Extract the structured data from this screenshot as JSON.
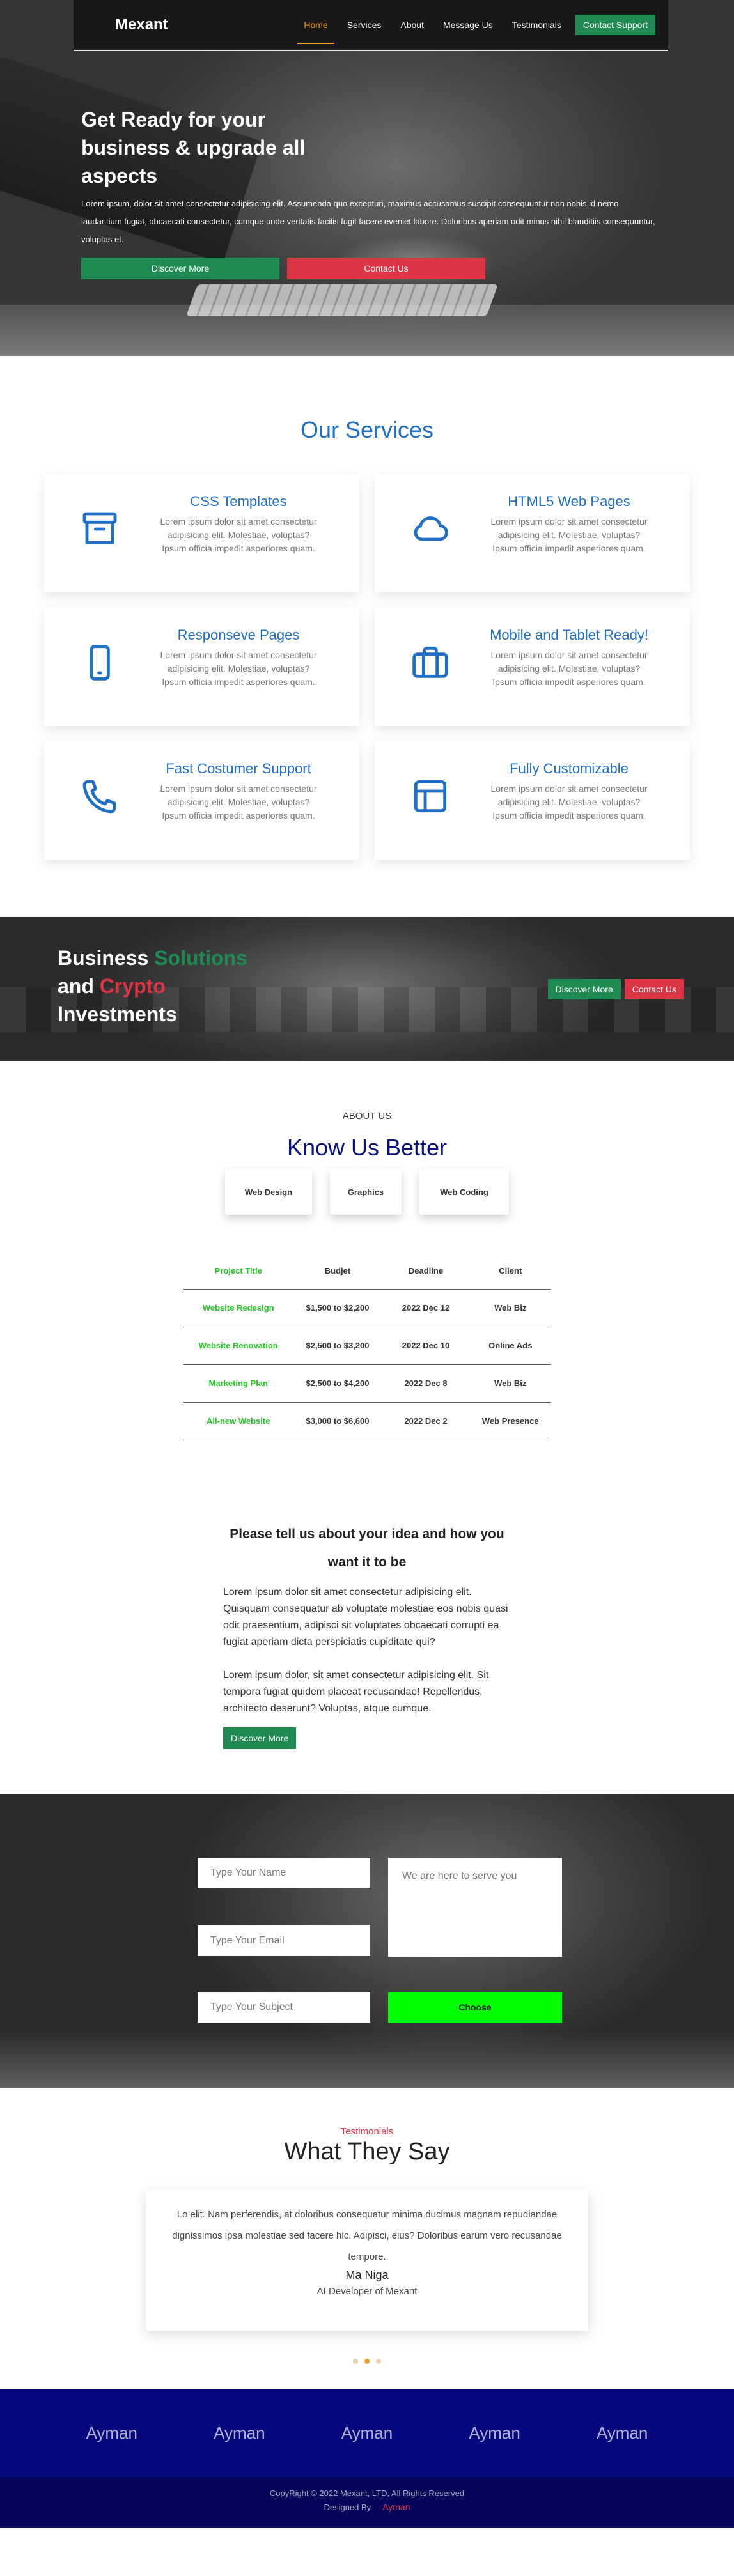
{
  "nav": {
    "logo": "Mexant",
    "links": [
      "Home",
      "Services",
      "About",
      "Message Us",
      "Testimonials"
    ],
    "cta": "Contact Support"
  },
  "hero": {
    "title": "Get Ready for your business & upgrade all aspects",
    "text": "Lorem ipsum, dolor sit amet consectetur adipisicing elit. Assumenda quo excepturi, maximus accusamus suscipit consequuntur non nobis id nemo laudantium fugiat, obcaecati consectetur, cumque unde veritatis facilis fugit facere eveniet labore. Doloribus aperiam odit minus nihil blanditiis consequuntur, voluptas et.",
    "btn_discover": "Discover More",
    "btn_contact": "Contact Us"
  },
  "services": {
    "title": "Our Services",
    "items": [
      {
        "icon": "archive-icon",
        "title": "CSS Templates",
        "desc": "Lorem ipsum dolor sit amet consectetur adipisicing elit. Molestiae, voluptas? Ipsum officia impedit asperiores quam."
      },
      {
        "icon": "cloud-icon",
        "title": "HTML5 Web Pages",
        "desc": "Lorem ipsum dolor sit amet consectetur adipisicing elit. Molestiae, voluptas? Ipsum officia impedit asperiores quam."
      },
      {
        "icon": "phone-device-icon",
        "title": "Responseve Pages",
        "desc": "Lorem ipsum dolor sit amet consectetur adipisicing elit. Molestiae, voluptas? Ipsum officia impedit asperiores quam."
      },
      {
        "icon": "briefcase-icon",
        "title": "Mobile and Tablet Ready!",
        "desc": "Lorem ipsum dolor sit amet consectetur adipisicing elit. Molestiae, voluptas? Ipsum officia impedit asperiores quam."
      },
      {
        "icon": "telephone-icon",
        "title": "Fast Costumer Support",
        "desc": "Lorem ipsum dolor sit amet consectetur adipisicing elit. Molestiae, voluptas? Ipsum officia impedit asperiores quam."
      },
      {
        "icon": "layout-icon",
        "title": "Fully Customizable",
        "desc": "Lorem ipsum dolor sit amet consectetur adipisicing elit. Molestiae, voluptas? Ipsum officia impedit asperiores quam."
      }
    ]
  },
  "banner": {
    "line1_a": "Business ",
    "line1_b": "Solutions",
    "line2_a": "and ",
    "line2_b": "Crypto",
    "line3": "Investments",
    "btn_discover": "Discover More",
    "btn_contact": "Contact Us"
  },
  "about": {
    "label": "ABOUT US",
    "title": "Know Us Better",
    "tabs": [
      "Web Design",
      "Graphics",
      "Web Coding"
    ],
    "table": {
      "headers": [
        "Project Title",
        "Budjet",
        "Deadline",
        "Client"
      ],
      "rows": [
        [
          "Website Redesign",
          "$1,500 to $2,200",
          "2022 Dec 12",
          "Web Biz"
        ],
        [
          "Website Renovation",
          "$2,500 to $3,200",
          "2022 Dec 10",
          "Online Ads"
        ],
        [
          "Marketing Plan",
          "$2,500 to $4,200",
          "2022 Dec 8",
          "Web Biz"
        ],
        [
          "All-new Website",
          "$3,000 to $6,600",
          "2022 Dec 2",
          "Web Presence"
        ]
      ]
    }
  },
  "idea": {
    "title": "Please tell us about your idea and how you want it to be",
    "para1": "Lorem ipsum dolor sit amet consectetur adipisicing elit. Quisquam consequatur ab voluptate molestiae eos nobis quasi odit praesentium, adipisci sit voluptates obcaecati corrupti ea fugiat aperiam dicta perspiciatis cupiditate qui?",
    "para2": "Lorem ipsum dolor, sit amet consectetur adipisicing elit. Sit tempora fugiat quidem placeat recusandae! Repellendus, architecto deserunt? Voluptas, atque cumque.",
    "btn": "Discover More"
  },
  "contact": {
    "name_placeholder": "Type Your Name",
    "email_placeholder": "Type Your Email",
    "subject_placeholder": "Type Your Subject",
    "message_placeholder": "We are here to serve you",
    "btn": "Choose"
  },
  "testimonials": {
    "label": "Testimonials",
    "title": "What They Say",
    "text": "Lo elit. Nam perferendis, at doloribus consequatur minima ducimus magnam repudiandae dignissimos ipsa molestiae sed facere hic. Adipisci, eius? Doloribus earum vero recusandae tempore.",
    "name": "Ma Niga",
    "role": "AI Developer of Mexant",
    "active_dot": 1
  },
  "brands": [
    "Ayman",
    "Ayman",
    "Ayman",
    "Ayman",
    "Ayman"
  ],
  "footer": {
    "copyright": "CopyRight © 2022 Mexant, LTD, All Rights Reserved",
    "designed_by": "Designed By",
    "designer": "Ayman"
  }
}
